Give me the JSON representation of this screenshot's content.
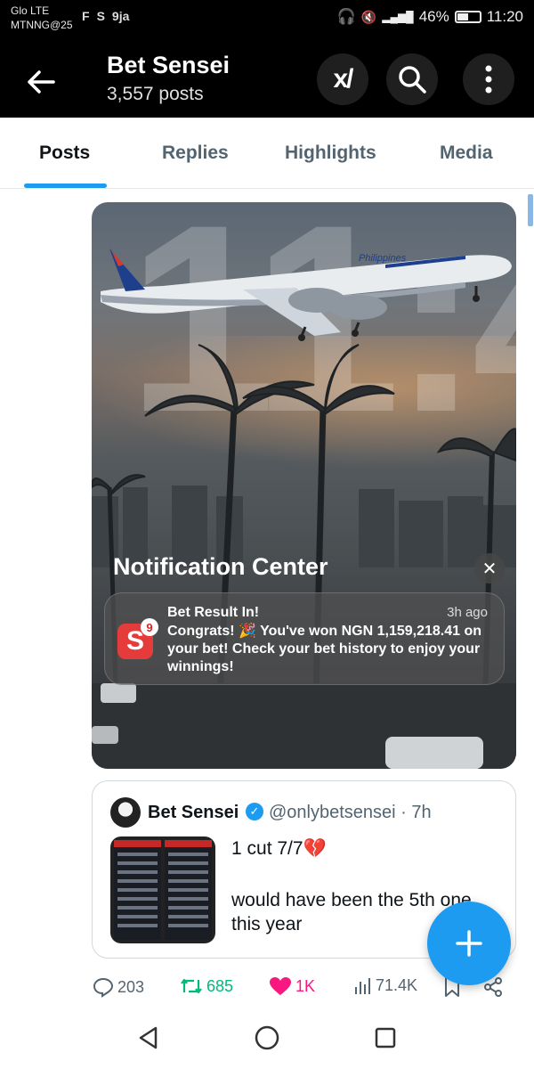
{
  "status_bar": {
    "carrier_line1": "Glo LTE",
    "carrier_line2": "MTNNG@25",
    "left_icons": [
      "F",
      "S",
      "9ja"
    ],
    "battery": "46%",
    "time": "11:20"
  },
  "header": {
    "title": "Bet Sensei",
    "post_count": "3,557 posts"
  },
  "tabs": [
    {
      "label": "Posts",
      "active": true
    },
    {
      "label": "Replies",
      "active": false
    },
    {
      "label": "Highlights",
      "active": false
    },
    {
      "label": "Media",
      "active": false
    }
  ],
  "media": {
    "notification_center_title": "Notification Center",
    "notification": {
      "app_badge": "9",
      "title": "Bet Result In!",
      "time": "3h ago",
      "body": "Congrats! 🎉 You've won NGN 1,159,218.41 on your bet! Check your bet history to enjoy your winnings!"
    },
    "plane_text": "Philippines"
  },
  "quote": {
    "name": "Bet Sensei",
    "handle": "@onlybetsensei · 7h",
    "line1": "1 cut 7/7💔",
    "line2": "would have been the 5th one this year"
  },
  "actions": {
    "replies": "203",
    "reposts": "685",
    "likes": "1K",
    "views": "71.4K"
  },
  "colors": {
    "accent": "#1d9bf0",
    "repost": "#00ba7c",
    "like": "#f91880"
  }
}
